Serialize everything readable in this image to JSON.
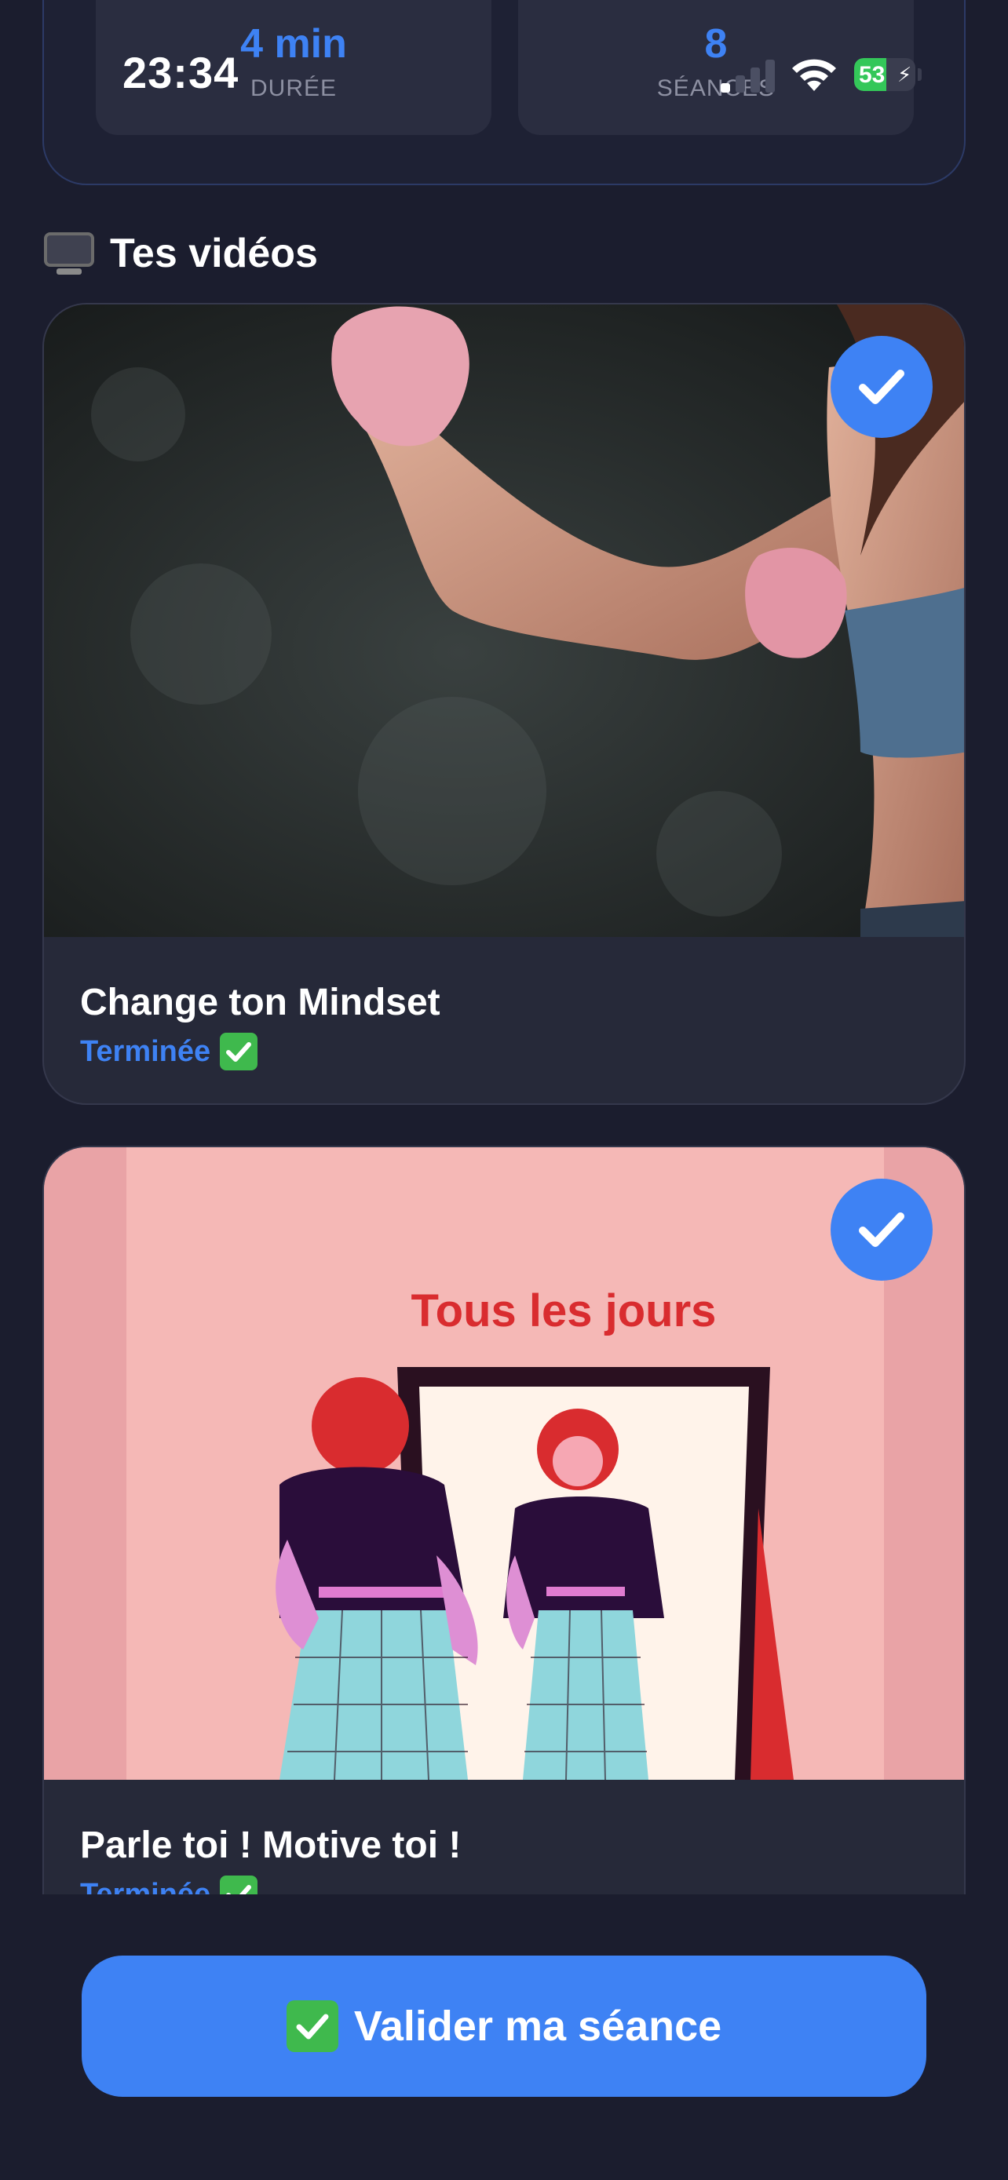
{
  "status_bar": {
    "time": "23:34",
    "battery_percent": "53",
    "battery_level": 0.53,
    "icons": [
      "signal-icon",
      "wifi-icon",
      "battery-charging-icon"
    ]
  },
  "stats": {
    "duration_value": "4 min",
    "duration_label": "DURÉE",
    "sessions_value": "8",
    "sessions_label": "SÉANCES"
  },
  "videos_section": {
    "icon": "tv-icon",
    "title": "Tes vidéos"
  },
  "videos": [
    {
      "title": "Change ton Mindset",
      "status": "Terminée",
      "completed": true
    },
    {
      "title": "Parle toi ! Motive toi !",
      "status": "Terminée",
      "completed": true,
      "thumbnail_text": "Tous les jours"
    }
  ],
  "validate_button": {
    "label": "Valider ma séance"
  },
  "colors": {
    "background": "#1b1d2e",
    "card": "#262939",
    "accent": "#3e82f4",
    "success": "#3fb94d"
  }
}
